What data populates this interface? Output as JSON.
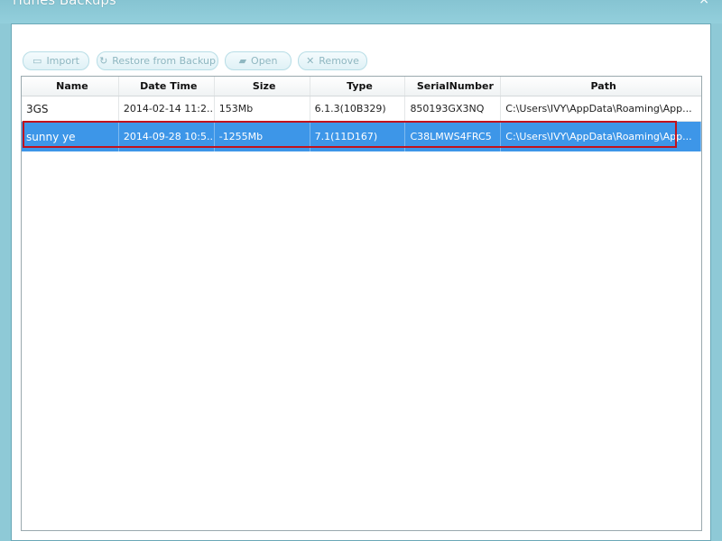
{
  "window": {
    "title": "iTunes Backups",
    "close_label": "×"
  },
  "toolbar": {
    "import": {
      "label": "Import",
      "icon": "import-icon",
      "glyph": "▭"
    },
    "restore": {
      "label": "Restore from Backup",
      "icon": "restore-icon",
      "glyph": "↻"
    },
    "open": {
      "label": "Open",
      "icon": "folder-open-icon",
      "glyph": "▰"
    },
    "remove": {
      "label": "Remove",
      "icon": "remove-icon",
      "glyph": "✕"
    }
  },
  "table": {
    "columns": [
      "Name",
      "Date Time",
      "Size",
      "Type",
      "SerialNumber",
      "Path"
    ],
    "rows": [
      {
        "name": "3GS",
        "date": "2014-02-14 11:2...",
        "size": "153Mb",
        "type": "6.1.3(10B329)",
        "serial": "850193GX3NQ",
        "path": "C:\\Users\\IVY\\AppData\\Roaming\\App..."
      },
      {
        "name": "sunny ye",
        "date": "2014-09-28 10:5...",
        "size": "-1255Mb",
        "type": "7.1(11D167)",
        "serial": "C38LMWS4FRC5",
        "path": "C:\\Users\\IVY\\AppData\\Roaming\\App..."
      }
    ],
    "selected_row": 1
  },
  "colors": {
    "selection": "#3d96e8",
    "highlight_outline": "#c2121c",
    "frame": "#8ec9d6"
  }
}
